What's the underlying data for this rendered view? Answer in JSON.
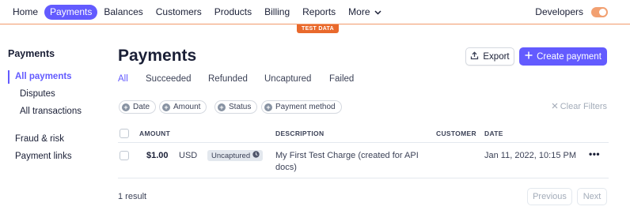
{
  "topnav": {
    "items": [
      {
        "label": "Home",
        "active": false
      },
      {
        "label": "Payments",
        "active": true
      },
      {
        "label": "Balances",
        "active": false
      },
      {
        "label": "Customers",
        "active": false
      },
      {
        "label": "Products",
        "active": false
      },
      {
        "label": "Billing",
        "active": false
      },
      {
        "label": "Reports",
        "active": false
      },
      {
        "label": "More",
        "active": false
      }
    ],
    "developers_label": "Developers",
    "test_mode_toggle": "on",
    "test_badge": "TEST DATA"
  },
  "sidebar": {
    "heading": "Payments",
    "items": [
      {
        "label": "All payments",
        "active": true
      },
      {
        "label": "Disputes",
        "active": false
      },
      {
        "label": "All transactions",
        "active": false
      },
      {
        "label": "Fraud & risk",
        "active": false
      },
      {
        "label": "Payment links",
        "active": false
      }
    ]
  },
  "main": {
    "title": "Payments",
    "export_label": "Export",
    "create_label": "Create payment",
    "tabs": [
      {
        "label": "All",
        "active": true
      },
      {
        "label": "Succeeded",
        "active": false
      },
      {
        "label": "Refunded",
        "active": false
      },
      {
        "label": "Uncaptured",
        "active": false
      },
      {
        "label": "Failed",
        "active": false
      }
    ],
    "filters": [
      "Date",
      "Amount",
      "Status",
      "Payment method"
    ],
    "clear_filters": "Clear Filters"
  },
  "table": {
    "columns": {
      "amount": "AMOUNT",
      "description": "DESCRIPTION",
      "customer": "CUSTOMER",
      "date": "DATE"
    },
    "rows": [
      {
        "amount": "$1.00",
        "currency": "USD",
        "status": "Uncaptured",
        "description": "My First Test Charge (created for API docs)",
        "customer": "",
        "date": "Jan 11, 2022, 10:15 PM",
        "more": "•••"
      }
    ]
  },
  "footer": {
    "result_count": "1 result",
    "previous": "Previous",
    "next": "Next"
  },
  "colors": {
    "accent": "#635bff",
    "test_mode": "#e9692c"
  }
}
